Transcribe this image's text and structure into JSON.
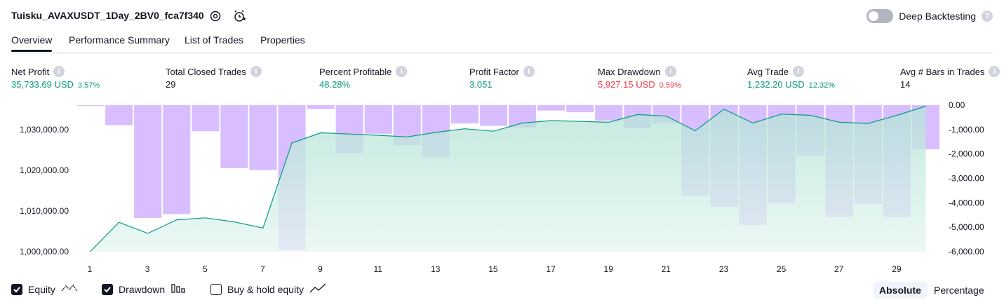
{
  "header": {
    "title": "Tuisku_AVAXUSDT_1Day_2BV0_fca7f340",
    "settings_icon": "gear-icon",
    "alert_icon": "alarm-clock-plus-icon",
    "toggle_label": "Deep Backtesting",
    "toggle_on": false
  },
  "tabs": [
    {
      "label": "Overview",
      "active": true
    },
    {
      "label": "Performance Summary",
      "active": false
    },
    {
      "label": "List of Trades",
      "active": false
    },
    {
      "label": "Properties",
      "active": false
    }
  ],
  "metrics": [
    {
      "label": "Net Profit",
      "value": "35,733.69 USD",
      "pct": "3.57%",
      "color": "green"
    },
    {
      "label": "Total Closed Trades",
      "value": "29",
      "pct": "",
      "color": "dark"
    },
    {
      "label": "Percent Profitable",
      "value": "48.28%",
      "pct": "",
      "color": "green"
    },
    {
      "label": "Profit Factor",
      "value": "3.051",
      "pct": "",
      "color": "green"
    },
    {
      "label": "Max Drawdown",
      "value": "5,927.15 USD",
      "pct": "0.59%",
      "color": "red"
    },
    {
      "label": "Avg Trade",
      "value": "1,232.20 USD",
      "pct": "12.32%",
      "color": "green"
    },
    {
      "label": "Avg # Bars in Trades",
      "value": "14",
      "pct": "",
      "color": "dark"
    }
  ],
  "chart_data": {
    "type": "line",
    "x": [
      1,
      2,
      3,
      4,
      5,
      6,
      7,
      8,
      9,
      10,
      11,
      12,
      13,
      14,
      15,
      16,
      17,
      18,
      19,
      20,
      21,
      22,
      23,
      24,
      25,
      26,
      27,
      28,
      29,
      30
    ],
    "xticks": [
      "1",
      "3",
      "5",
      "7",
      "9",
      "11",
      "13",
      "15",
      "17",
      "19",
      "21",
      "23",
      "25",
      "27",
      "29"
    ],
    "series": [
      {
        "name": "Equity",
        "type": "area",
        "axis": "left",
        "color": "#089981",
        "values": [
          1000000,
          1007200,
          1004500,
          1007800,
          1008300,
          1007300,
          1005800,
          1026700,
          1029200,
          1028900,
          1028600,
          1028200,
          1029300,
          1030200,
          1029600,
          1031600,
          1032200,
          1032000,
          1031800,
          1033700,
          1033300,
          1029700,
          1035000,
          1031600,
          1033800,
          1033500,
          1031800,
          1031500,
          1033500,
          1035734
        ]
      },
      {
        "name": "Drawdown",
        "type": "bar",
        "axis": "right",
        "color": "#d1b3ff",
        "values": [
          -25,
          -820,
          -4620,
          -4460,
          -1070,
          -2580,
          -2660,
          -5927,
          -160,
          -1980,
          -1170,
          -1640,
          -2140,
          -750,
          -850,
          -920,
          -220,
          -290,
          -640,
          -940,
          -740,
          -3710,
          -4170,
          -4920,
          -4010,
          -2080,
          -4570,
          -4040,
          -4580,
          -1810
        ]
      }
    ],
    "yticks_left": [
      "1,000,000.00",
      "1,010,000.00",
      "1,020,000.00",
      "1,030,000.00"
    ],
    "ylim_left": [
      1000000,
      1036000
    ],
    "yticks_right": [
      "0.00",
      "-1,000.00",
      "-2,000.00",
      "-3,000.00",
      "-4,000.00",
      "-5,000.00",
      "-6,000.00"
    ],
    "ylim_right": [
      -6000,
      0
    ],
    "grid": false
  },
  "legend": [
    {
      "label": "Equity",
      "checked": true,
      "icon": "equity-line-icon"
    },
    {
      "label": "Drawdown",
      "checked": true,
      "icon": "drawdown-bars-icon"
    },
    {
      "label": "Buy & hold equity",
      "checked": false,
      "icon": "buy-hold-line-icon"
    }
  ],
  "view_mode": {
    "absolute": "Absolute",
    "percentage": "Percentage",
    "selected": "Absolute"
  },
  "colors": {
    "green": "#089981",
    "red": "#f23645",
    "drawdown": "#d1b3ff",
    "equity_fill": "#c8ebe2"
  }
}
